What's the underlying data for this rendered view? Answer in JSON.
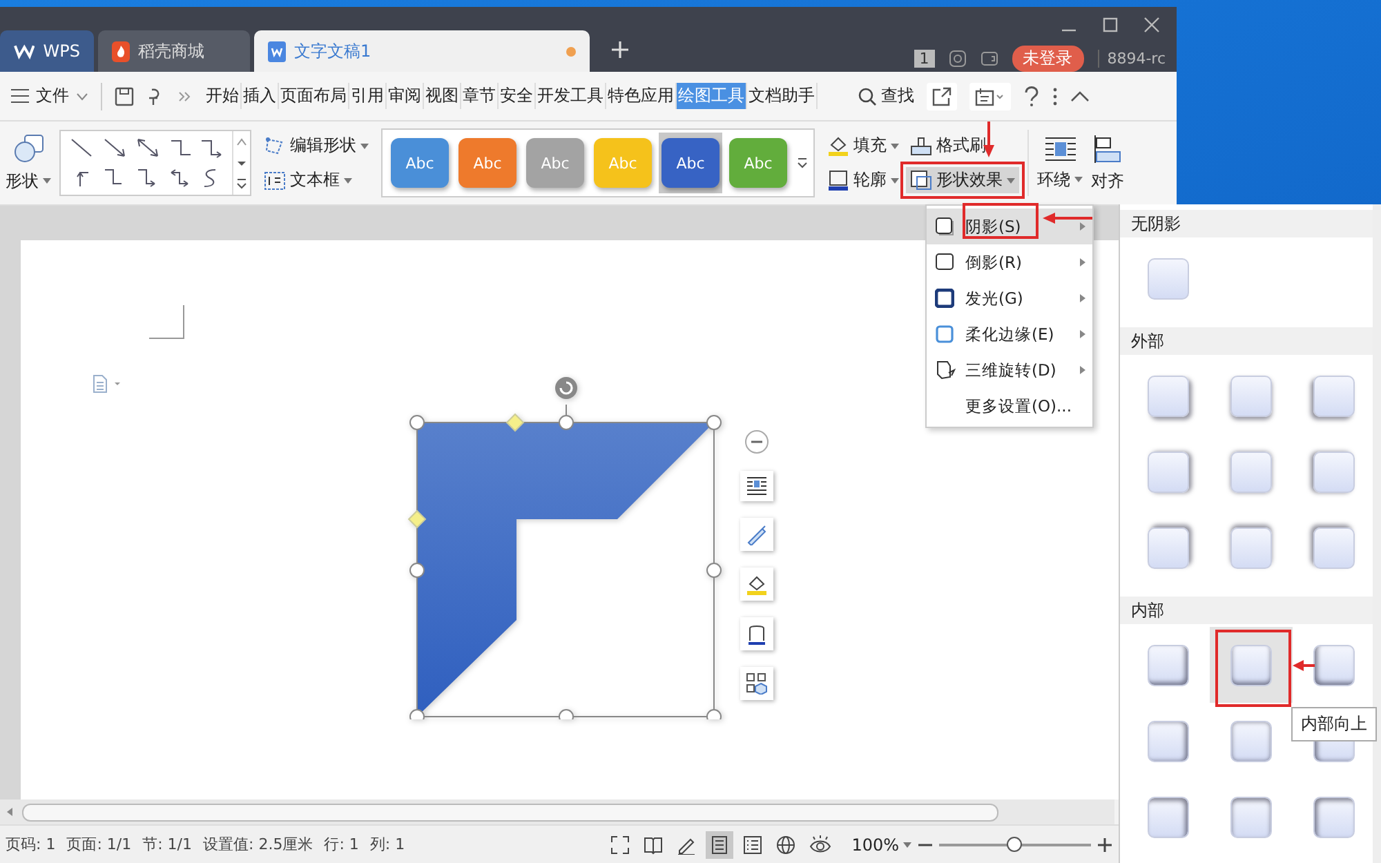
{
  "window": {
    "tabs": [
      {
        "label": "WPS",
        "kind": "home",
        "selected": false
      },
      {
        "label": "稻壳商城",
        "kind": "store",
        "selected": false
      },
      {
        "label": "文字文稿1",
        "kind": "doc",
        "selected": true,
        "unsaved": true
      }
    ],
    "badge": "1",
    "login": "未登录",
    "user": "8894-rc"
  },
  "menu_bar": {
    "file": "文件",
    "tabs": [
      {
        "label": "开始",
        "selected": false
      },
      {
        "label": "插入",
        "selected": false
      },
      {
        "label": "页面布局",
        "selected": false
      },
      {
        "label": "引用",
        "selected": false
      },
      {
        "label": "审阅",
        "selected": false
      },
      {
        "label": "视图",
        "selected": false
      },
      {
        "label": "章节",
        "selected": false
      },
      {
        "label": "安全",
        "selected": false
      },
      {
        "label": "开发工具",
        "selected": false
      },
      {
        "label": "特色应用",
        "selected": false
      },
      {
        "label": "绘图工具",
        "selected": true
      },
      {
        "label": "文档助手",
        "selected": false
      }
    ],
    "search": "查找"
  },
  "ribbon": {
    "shape": "形状",
    "edit_shape": "编辑形状",
    "text_box": "文本框",
    "styles": [
      {
        "label": "Abc",
        "color": "#4a8fd8",
        "selected": false
      },
      {
        "label": "Abc",
        "color": "#ee7a2c",
        "selected": false
      },
      {
        "label": "Abc",
        "color": "#a3a3a3",
        "selected": false
      },
      {
        "label": "Abc",
        "color": "#f5c21b",
        "selected": false
      },
      {
        "label": "Abc",
        "color": "#3763c4",
        "selected": true
      },
      {
        "label": "Abc",
        "color": "#62ad3c",
        "selected": false
      }
    ],
    "fill": "填充",
    "format_painter": "格式刷",
    "outline": "轮廓",
    "effects": {
      "label": "形状效果",
      "expanded": true
    },
    "wrap": "环绕",
    "align": "对齐"
  },
  "effects_menu": [
    {
      "label": "阴影(S)",
      "kind": "shadow",
      "selected": true,
      "submenu": true
    },
    {
      "label": "倒影(R)",
      "kind": "reflection",
      "selected": false,
      "submenu": true
    },
    {
      "label": "发光(G)",
      "kind": "glow",
      "selected": false,
      "submenu": true
    },
    {
      "label": "柔化边缘(E)",
      "kind": "soft",
      "selected": false,
      "submenu": true
    },
    {
      "label": "三维旋转(D)",
      "kind": "rotate",
      "selected": false,
      "submenu": true
    },
    {
      "label": "更多设置(O)...",
      "kind": "more",
      "selected": false,
      "submenu": false
    }
  ],
  "shadow_gallery": {
    "sections": [
      {
        "title": "无阴影",
        "kind": "none",
        "items": [
          {
            "selected": false
          }
        ]
      },
      {
        "title": "外部",
        "kind": "outer",
        "items": [
          {
            "selected": false
          },
          {
            "selected": false
          },
          {
            "selected": false
          },
          {
            "selected": false
          },
          {
            "selected": false
          },
          {
            "selected": false
          },
          {
            "selected": false
          },
          {
            "selected": false
          },
          {
            "selected": false
          }
        ]
      },
      {
        "title": "内部",
        "kind": "inner",
        "items": [
          {
            "selected": false
          },
          {
            "selected": true
          },
          {
            "selected": false
          },
          {
            "selected": false
          },
          {
            "selected": false
          },
          {
            "selected": false
          },
          {
            "selected": false
          },
          {
            "selected": false
          },
          {
            "selected": false
          }
        ]
      }
    ],
    "tooltip": "内部向上"
  },
  "status_bar": {
    "items": [
      "页码: 1",
      "页面: 1/1",
      "节: 1/1",
      "设置值: 2.5厘米",
      "行: 1",
      "列: 1"
    ],
    "views": [
      {
        "kind": "fullscreen",
        "selected": false
      },
      {
        "kind": "read",
        "selected": false
      },
      {
        "kind": "pen",
        "selected": false
      },
      {
        "kind": "page",
        "selected": true
      },
      {
        "kind": "outline",
        "selected": false
      },
      {
        "kind": "web",
        "selected": false
      },
      {
        "kind": "eye",
        "selected": false
      }
    ],
    "zoom": "100%",
    "zoom_slider": {
      "level": 0.5
    }
  }
}
